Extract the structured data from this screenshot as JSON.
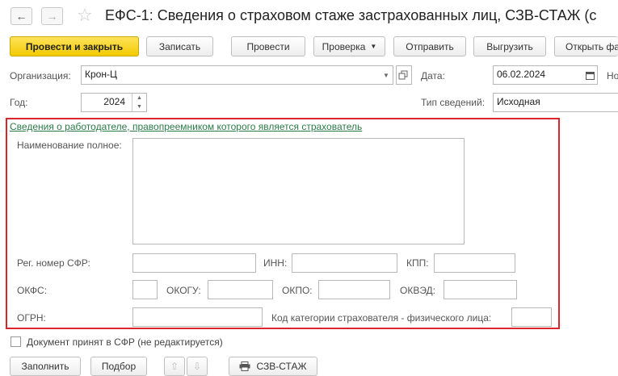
{
  "window": {
    "title": "ЕФС-1: Сведения о страховом стаже застрахованных лиц, СЗВ-СТАЖ (с",
    "back_icon": "arrow-left-icon",
    "forward_icon": "arrow-right-icon",
    "favorite_icon": "star-icon"
  },
  "toolbar": {
    "post_and_close": "Провести и закрыть",
    "save": "Записать",
    "post": "Провести",
    "check": "Проверка",
    "send": "Отправить",
    "export": "Выгрузить",
    "open_file": "Открыть фа"
  },
  "header": {
    "organization_label": "Организация:",
    "organization_value": "Крон-Ц",
    "date_label": "Дата:",
    "date_value": "06.02.2024",
    "number_label": "Но",
    "year_label": "Год:",
    "year_value": "2024",
    "info_type_label": "Тип сведений:",
    "info_type_value": "Исходная"
  },
  "employer": {
    "link": "Сведения о работодателе, правопреемником которого является страхователь",
    "full_name_label": "Наименование полное:",
    "full_name_value": "",
    "reg_number_label": "Рег. номер СФР:",
    "inn_label": "ИНН:",
    "kpp_label": "КПП:",
    "okfs_label": "ОКФС:",
    "okogu_label": "ОКОГУ:",
    "okpo_label": "ОКПО:",
    "okved_label": "ОКВЭД:",
    "ogrn_label": "ОГРН:",
    "category_label": "Код категории страхователя - физического лица:"
  },
  "accepted_label": "Документ принят в СФР (не редактируется)",
  "bottom": {
    "fill": "Заполнить",
    "select": "Подбор",
    "print": "СЗВ-СТАЖ"
  },
  "colors": {
    "primary_button": "#f2c900",
    "highlight_frame": "#d9252b",
    "link": "#2a7a46"
  }
}
